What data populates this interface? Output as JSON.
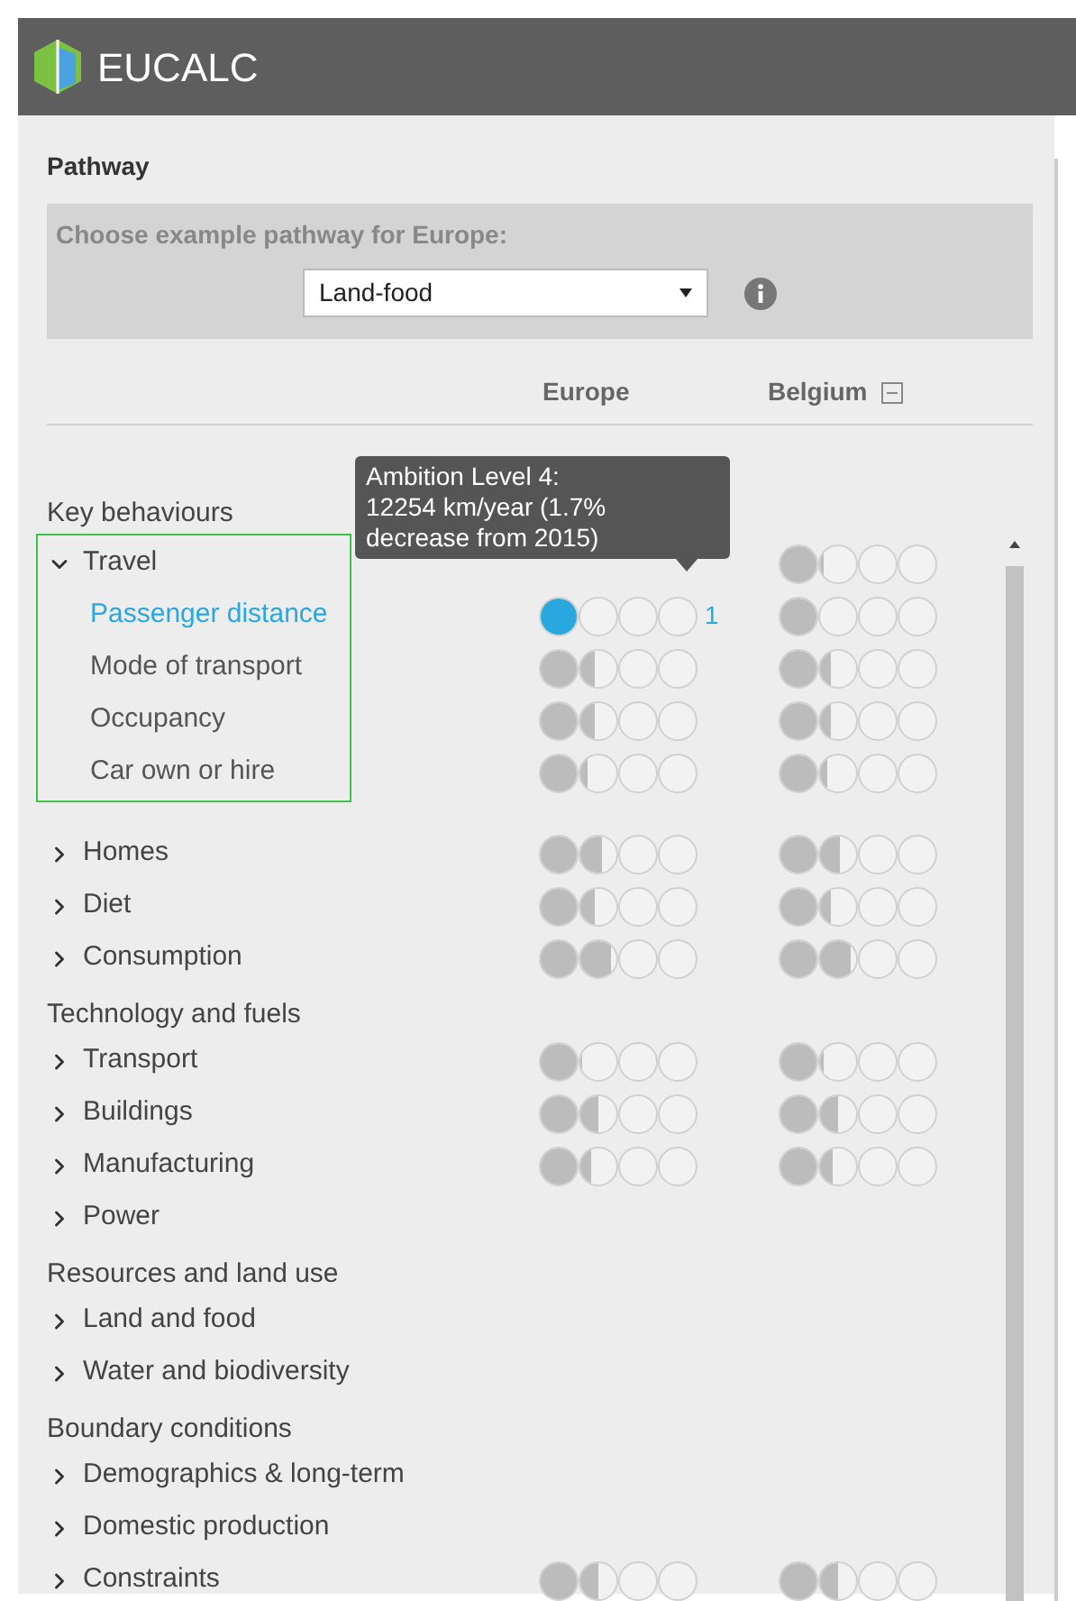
{
  "app": {
    "title": "EUCALC"
  },
  "pathway": {
    "heading": "Pathway",
    "prompt": "Choose example pathway for Europe:",
    "select_value": "Land-food"
  },
  "columns": [
    {
      "label": "Europe"
    },
    {
      "label": "Belgium",
      "collapsible": true
    }
  ],
  "tooltip": {
    "lines": [
      "Ambition Level 4:",
      "12254 km/year (1.7%",
      "decrease from 2015)"
    ]
  },
  "sections": [
    {
      "title": "Key behaviours",
      "items": [
        {
          "label": "Travel",
          "expanded": true,
          "outlined": true,
          "belgium": {
            "stars": 1.1
          },
          "children": [
            {
              "label": "Passenger distance",
              "selected": true,
              "europe": {
                "stars": 1,
                "reading": "1"
              },
              "belgium": {
                "stars": 1
              }
            },
            {
              "label": "Mode of transport",
              "selected": false,
              "europe": {
                "stars": 1.4
              },
              "belgium": {
                "stars": 1.3
              }
            },
            {
              "label": "Occupancy",
              "selected": false,
              "europe": {
                "stars": 1.4
              },
              "belgium": {
                "stars": 1.3
              }
            },
            {
              "label": "Car own or hire",
              "selected": false,
              "europe": {
                "stars": 1.2
              },
              "belgium": {
                "stars": 1.2
              }
            }
          ]
        },
        {
          "label": "Homes",
          "expanded": false,
          "outlined": false,
          "europe": {
            "stars": 1.6
          },
          "belgium": {
            "stars": 1.55
          }
        },
        {
          "label": "Diet",
          "expanded": false,
          "outlined": false,
          "europe": {
            "stars": 1.4
          },
          "belgium": {
            "stars": 1.3
          }
        },
        {
          "label": "Consumption",
          "expanded": false,
          "outlined": false,
          "europe": {
            "stars": 1.85
          },
          "belgium": {
            "stars": 1.85
          }
        }
      ]
    },
    {
      "title": "Technology and fuels",
      "items": [
        {
          "label": "Transport",
          "expanded": false,
          "outlined": false,
          "europe": {
            "stars": 1.05
          },
          "belgium": {
            "stars": 1.1
          }
        },
        {
          "label": "Buildings",
          "expanded": false,
          "outlined": false,
          "europe": {
            "stars": 1.5
          },
          "belgium": {
            "stars": 1.5
          }
        },
        {
          "label": "Manufacturing",
          "expanded": false,
          "outlined": false,
          "europe": {
            "stars": 1.3
          },
          "belgium": {
            "stars": 1.35
          }
        },
        {
          "label": "Power",
          "expanded": false,
          "outlined": false
        }
      ]
    },
    {
      "title": "Resources and land use",
      "items": [
        {
          "label": "Land and food",
          "expanded": false,
          "outlined": false
        },
        {
          "label": "Water and biodiversity",
          "expanded": false,
          "outlined": false
        }
      ]
    },
    {
      "title": "Boundary conditions",
      "items": [
        {
          "label": "Demographics & long-term",
          "expanded": false,
          "outlined": false
        },
        {
          "label": "Domestic production",
          "expanded": false,
          "outlined": false
        },
        {
          "label": "Constraints",
          "expanded": false,
          "outlined": false,
          "europe": {
            "stars": 1.5
          },
          "belgium": {
            "stars": 1.5
          }
        }
      ]
    }
  ]
}
